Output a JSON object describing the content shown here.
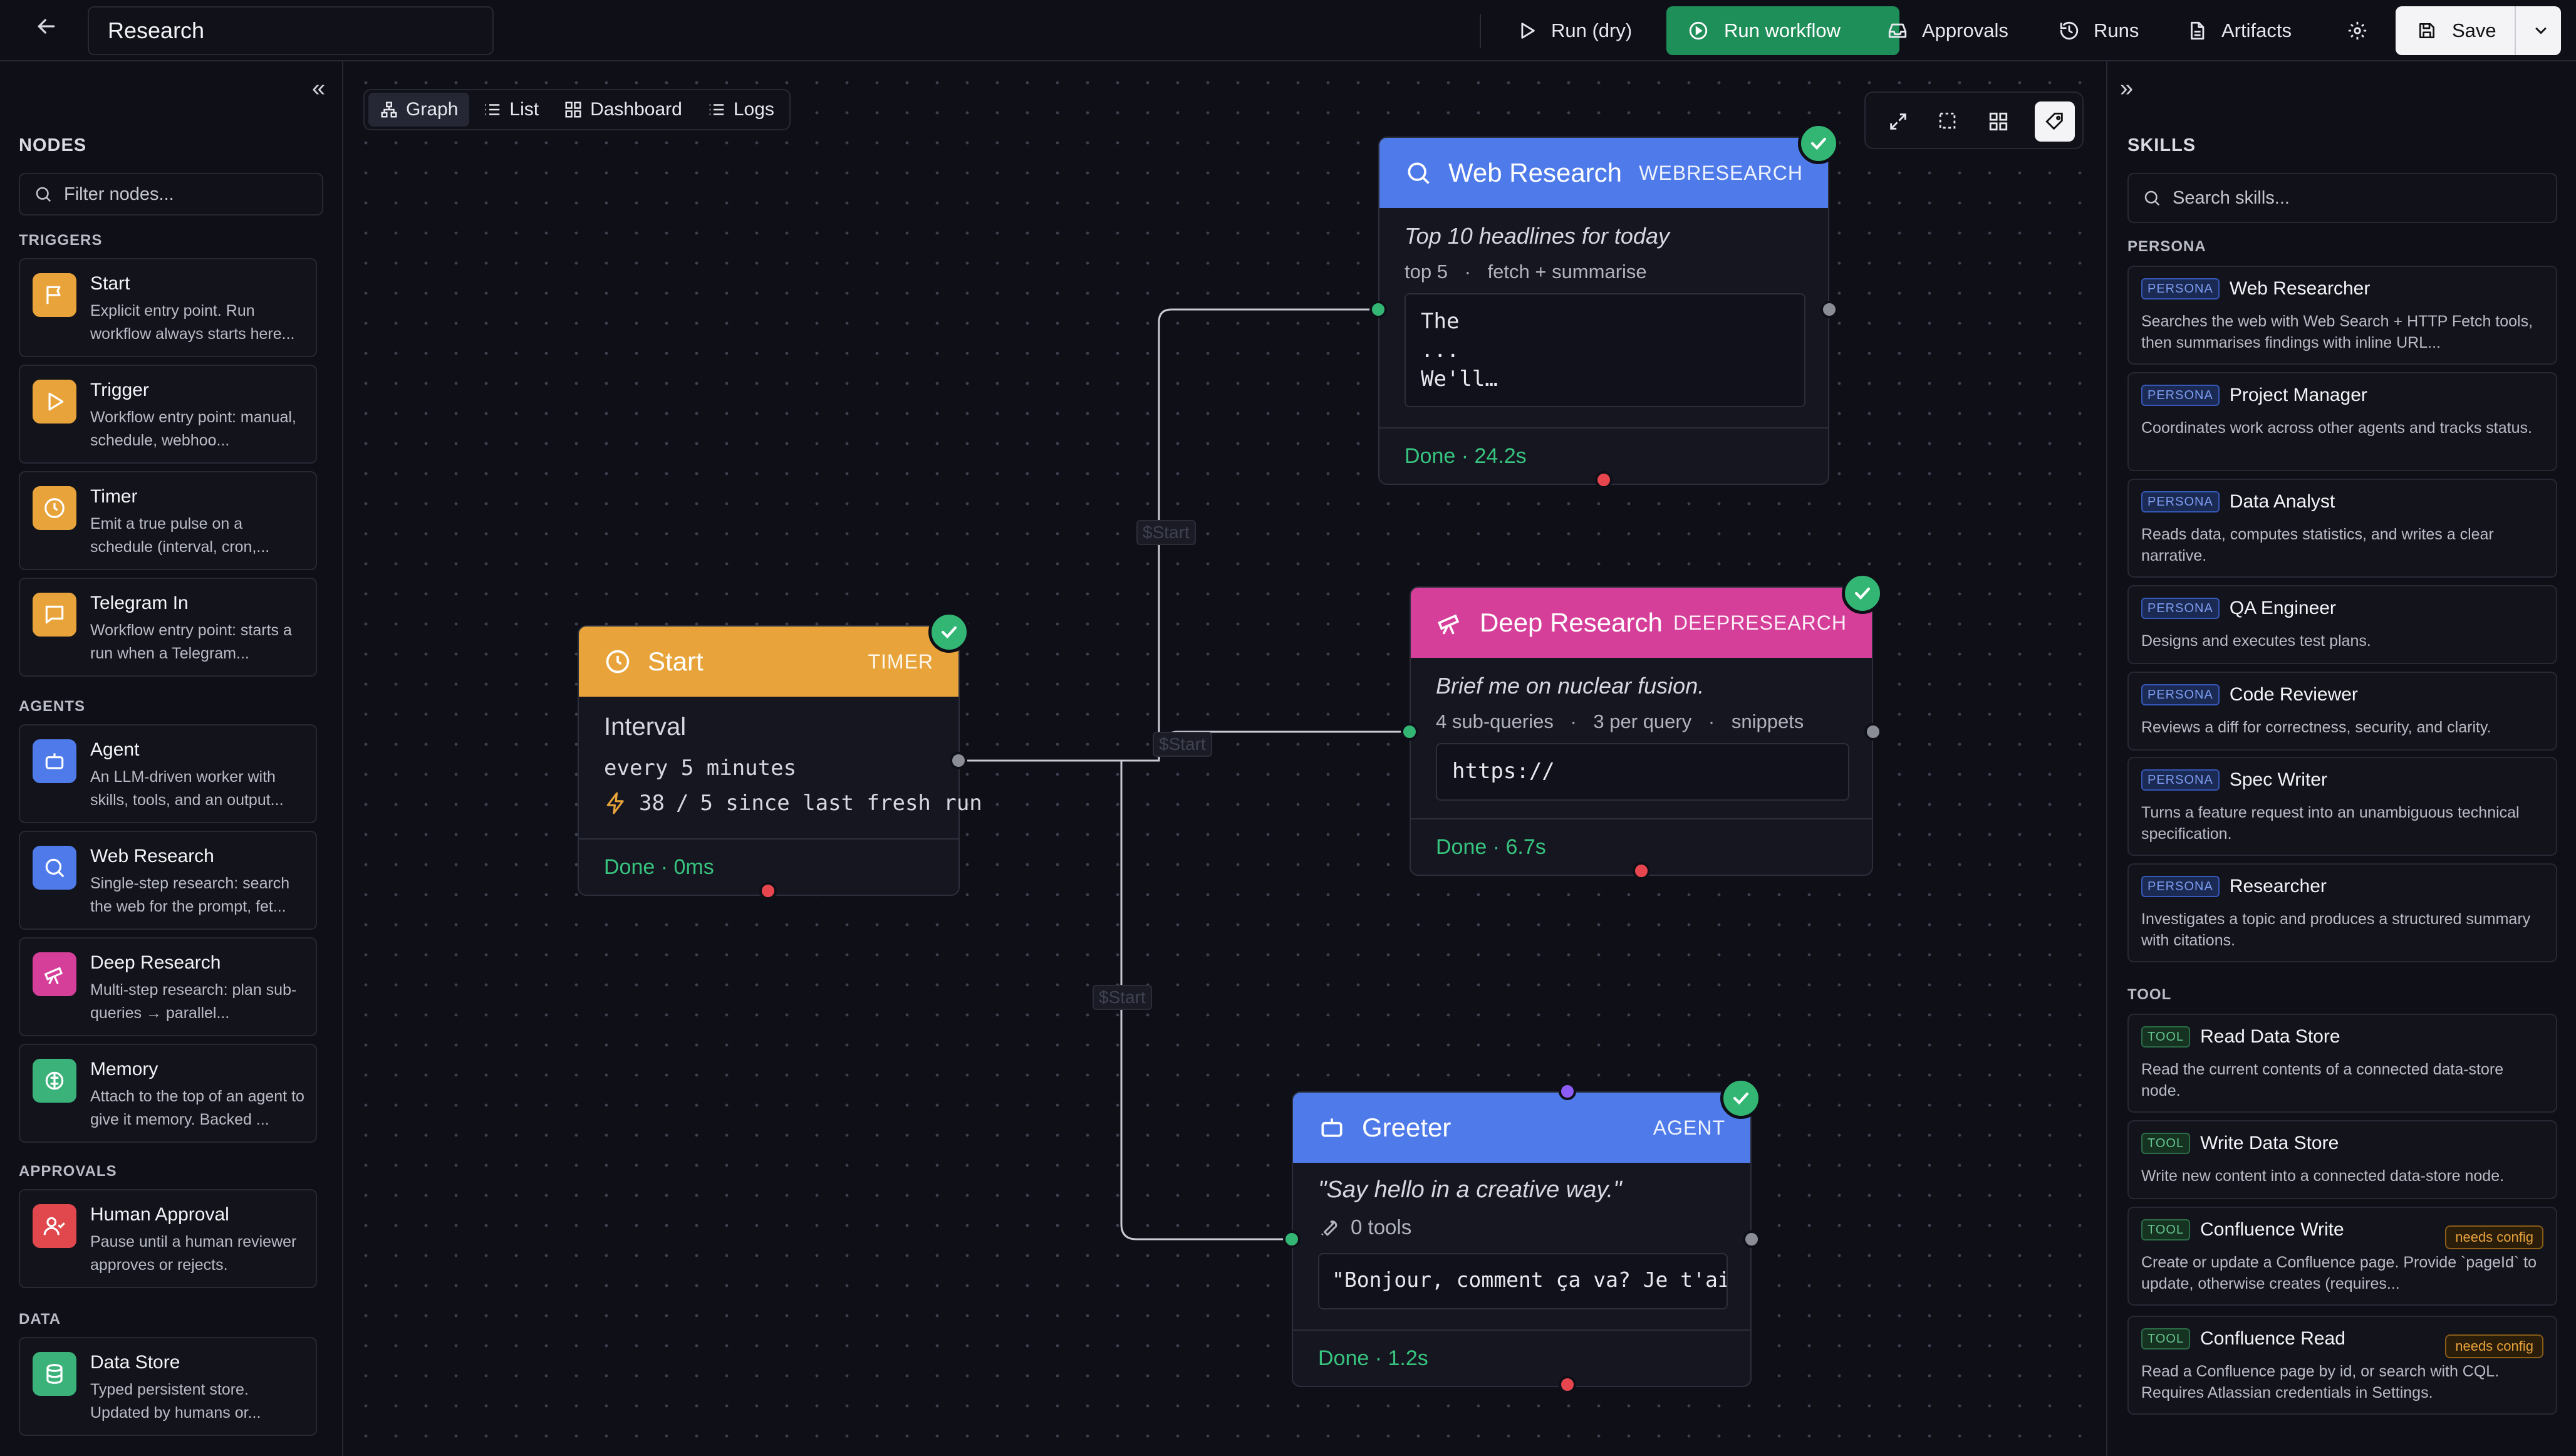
{
  "header": {
    "title": "Research",
    "run_dry": "Run (dry)",
    "run_workflow": "Run workflow",
    "approvals": "Approvals",
    "runs": "Runs",
    "artifacts": "Artifacts",
    "save": "Save"
  },
  "left": {
    "heading": "NODES",
    "filter_placeholder": "Filter nodes...",
    "sections": {
      "triggers": "TRIGGERS",
      "agents": "AGENTS",
      "approvals": "APPROVALS",
      "data": "DATA"
    },
    "items": [
      {
        "name": "Start",
        "desc": "Explicit entry point. Run workflow always starts here..."
      },
      {
        "name": "Trigger",
        "desc": "Workflow entry point: manual, schedule, webhoo..."
      },
      {
        "name": "Timer",
        "desc": "Emit a true pulse on a schedule (interval, cron,..."
      },
      {
        "name": "Telegram In",
        "desc": "Workflow entry point: starts a run when a Telegram..."
      },
      {
        "name": "Agent",
        "desc": "An LLM-driven worker with skills, tools, and an output..."
      },
      {
        "name": "Web Research",
        "desc": "Single-step research: search the web for the prompt, fet..."
      },
      {
        "name": "Deep Research",
        "desc": "Multi-step research: plan sub-queries → parallel..."
      },
      {
        "name": "Memory",
        "desc": "Attach to the top of an agent to give it memory. Backed ..."
      },
      {
        "name": "Human Approval",
        "desc": "Pause until a human reviewer approves or rejects."
      },
      {
        "name": "Data Store",
        "desc": "Typed persistent store. Updated by humans or..."
      }
    ]
  },
  "canvas": {
    "tabs": [
      "Graph",
      "List",
      "Dashboard",
      "Logs"
    ],
    "edge_label": "$Start",
    "nodes": {
      "web": {
        "title": "Web Research",
        "kind": "WEBRESEARCH",
        "prompt": "Top 10 headlines for today",
        "meta1": "top 5",
        "meta2": "fetch + summarise",
        "output": "The\n...\nWe'll…",
        "status": "Done · 24.2s"
      },
      "deep": {
        "title": "Deep Research",
        "kind": "DEEPRESEARCH",
        "prompt": "Brief me on nuclear fusion.",
        "meta1": "4 sub-queries",
        "meta2": "3 per query",
        "meta3": "snippets",
        "output": "https://",
        "status": "Done · 6.7s"
      },
      "start": {
        "title": "Start",
        "kind": "TIMER",
        "label": "Interval",
        "interval": "every 5 minutes",
        "count": "38",
        "slash": "/",
        "count_note": "5 since last fresh run",
        "status": "Done · 0ms"
      },
      "greeter": {
        "title": "Greeter",
        "kind": "AGENT",
        "prompt": "\"Say hello in a creative way.\"",
        "tools": "0 tools",
        "output": "\"Bonjour, comment ça va? Je t'aime.\"",
        "status": "Done · 1.2s"
      }
    },
    "meta_sep": "·"
  },
  "right": {
    "heading": "SKILLS",
    "search_placeholder": "Search skills...",
    "persona_heading": "PERSONA",
    "tool_heading": "TOOL",
    "persona_badge": "PERSONA",
    "tool_badge": "TOOL",
    "needs_config": "needs config",
    "personas": [
      {
        "name": "Web Researcher",
        "desc": "Searches the web with Web Search + HTTP Fetch tools, then summarises findings with inline URL..."
      },
      {
        "name": "Project Manager",
        "desc": "Coordinates work across other agents and tracks status."
      },
      {
        "name": "Data Analyst",
        "desc": "Reads data, computes statistics, and writes a clear narrative."
      },
      {
        "name": "QA Engineer",
        "desc": "Designs and executes test plans."
      },
      {
        "name": "Code Reviewer",
        "desc": "Reviews a diff for correctness, security, and clarity."
      },
      {
        "name": "Spec Writer",
        "desc": "Turns a feature request into an unambiguous technical specification."
      },
      {
        "name": "Researcher",
        "desc": "Investigates a topic and produces a structured summary with citations."
      }
    ],
    "tools": [
      {
        "name": "Read Data Store",
        "desc": "Read the current contents of a connected data-store node."
      },
      {
        "name": "Write Data Store",
        "desc": "Write new content into a connected data-store node."
      },
      {
        "name": "Confluence Write",
        "desc": "Create or update a Confluence page. Provide `pageId` to update, otherwise creates (requires..."
      },
      {
        "name": "Confluence Read",
        "desc": "Read a Confluence page by id, or search with CQL. Requires Atlassian credentials in Settings."
      }
    ]
  },
  "colors": {
    "accent_green": "#1f8f59",
    "timer": "#e8a43a",
    "web": "#4f7bea",
    "deep": "#d53f9a",
    "agent": "#4f7bea",
    "done": "#38c47f"
  }
}
